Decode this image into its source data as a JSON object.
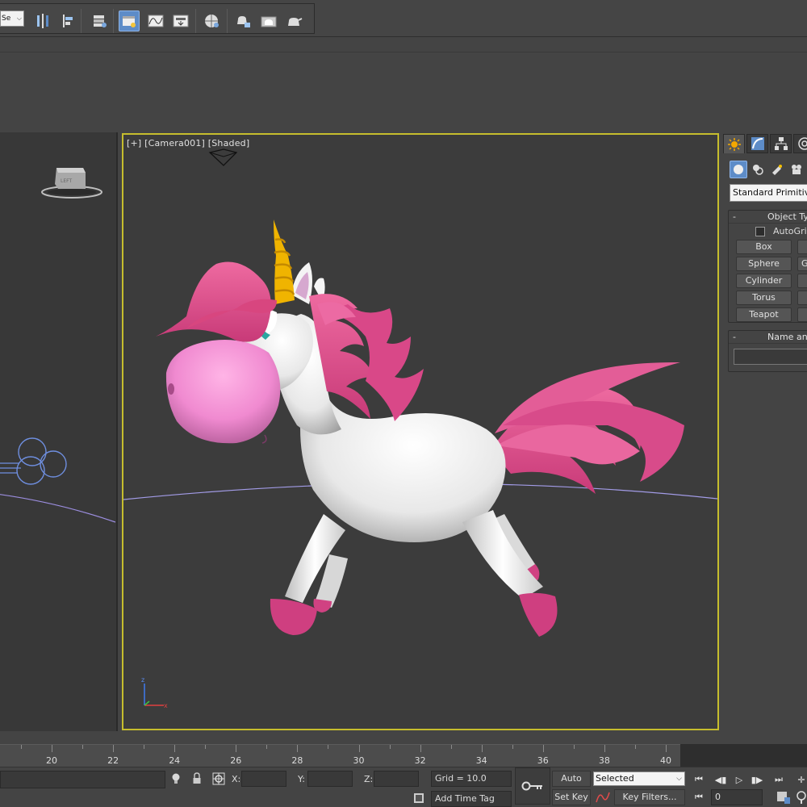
{
  "toolbar": {
    "selection_dropdown_value": "Se",
    "icons": [
      "mirror-icon",
      "align-icon",
      "layers-icon",
      "scene-explorer-icon",
      "curve-editor-icon",
      "schematic-view-icon",
      "material-editor-icon",
      "render-setup-icon",
      "rendered-frame-icon",
      "render-icon"
    ]
  },
  "viewport": {
    "label": "[+] [Camera001] [Shaded]",
    "left_viewcube_face": "LEFT"
  },
  "command_panel": {
    "tabs": [
      "create-tab",
      "modify-tab",
      "hierarchy-tab",
      "motion-tab"
    ],
    "subtabs": [
      "geometry",
      "shapes",
      "lights",
      "cameras"
    ],
    "category_dropdown": "Standard Primitives",
    "object_type": {
      "title": "Object Type",
      "autogrid_label": "AutoGrid",
      "buttons": [
        "Box",
        "Sphere",
        "Cylinder",
        "Torus",
        "Teapot"
      ],
      "buttons_right": [
        "",
        "G",
        "",
        "",
        ""
      ]
    },
    "name_and_color": {
      "title": "Name and Color",
      "name_value": ""
    }
  },
  "timeline": {
    "ticks": [
      "20",
      "22",
      "24",
      "26",
      "28",
      "30",
      "32",
      "34",
      "36",
      "38",
      "40"
    ]
  },
  "status": {
    "x_label": "X:",
    "y_label": "Y:",
    "z_label": "Z:",
    "grid": "Grid = 10.0",
    "add_time_tag": "Add Time Tag",
    "auto_key": "Auto Key",
    "set_key": "Set Key",
    "key_mode_value": "Selected",
    "key_filters": "Key Filters...",
    "current_frame": "0"
  },
  "colors": {
    "active_viewport_border": "#c6bd2d",
    "active_button": "#5d8cc8",
    "unicorn_mane": "#e0508a",
    "unicorn_horn": "#f0b400"
  }
}
